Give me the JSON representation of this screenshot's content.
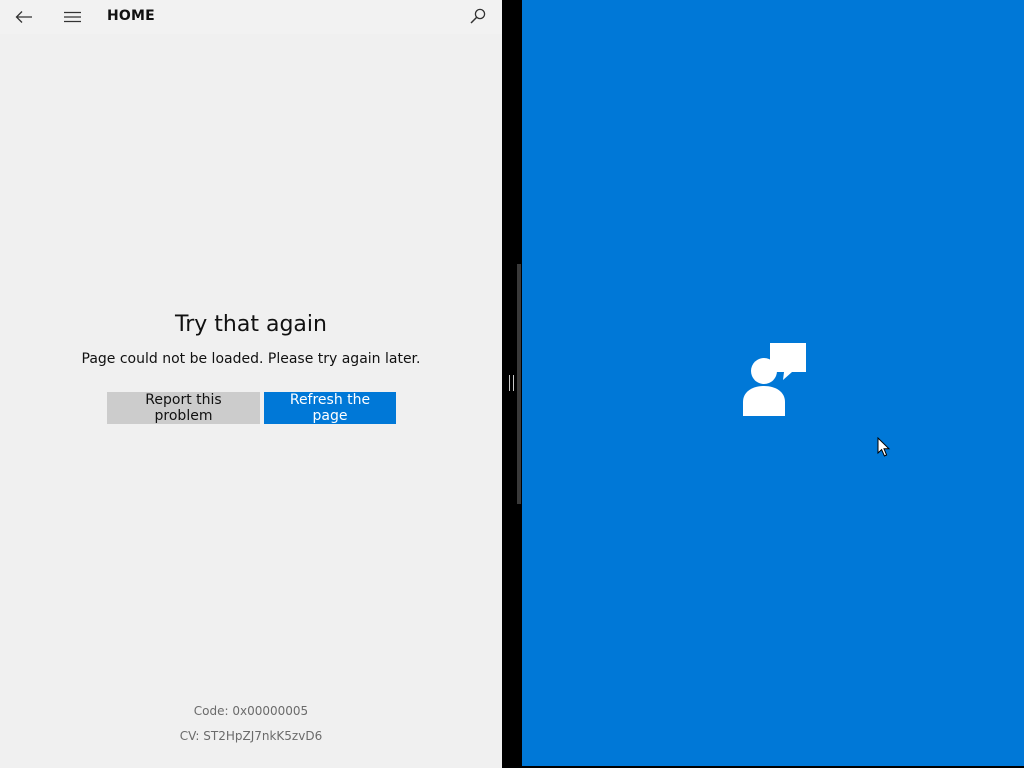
{
  "header": {
    "title": "HOME",
    "back_icon": "back-arrow-icon",
    "menu_icon": "hamburger-menu-icon",
    "search_icon": "search-icon"
  },
  "error": {
    "title": "Try that again",
    "message": "Page could not be loaded. Please try again later.",
    "report_label": "Report this problem",
    "refresh_label": "Refresh the page"
  },
  "footer": {
    "code": "Code: 0x00000005",
    "cv": "CV: ST2HpZJ7nkK5zvD6"
  },
  "right_pane": {
    "icon": "feedback-person-speech-icon",
    "background": "#0078d7"
  },
  "colors": {
    "accent": "#0078d7",
    "secondary_button": "#cccccc",
    "pane_background": "#f0f0f0"
  }
}
